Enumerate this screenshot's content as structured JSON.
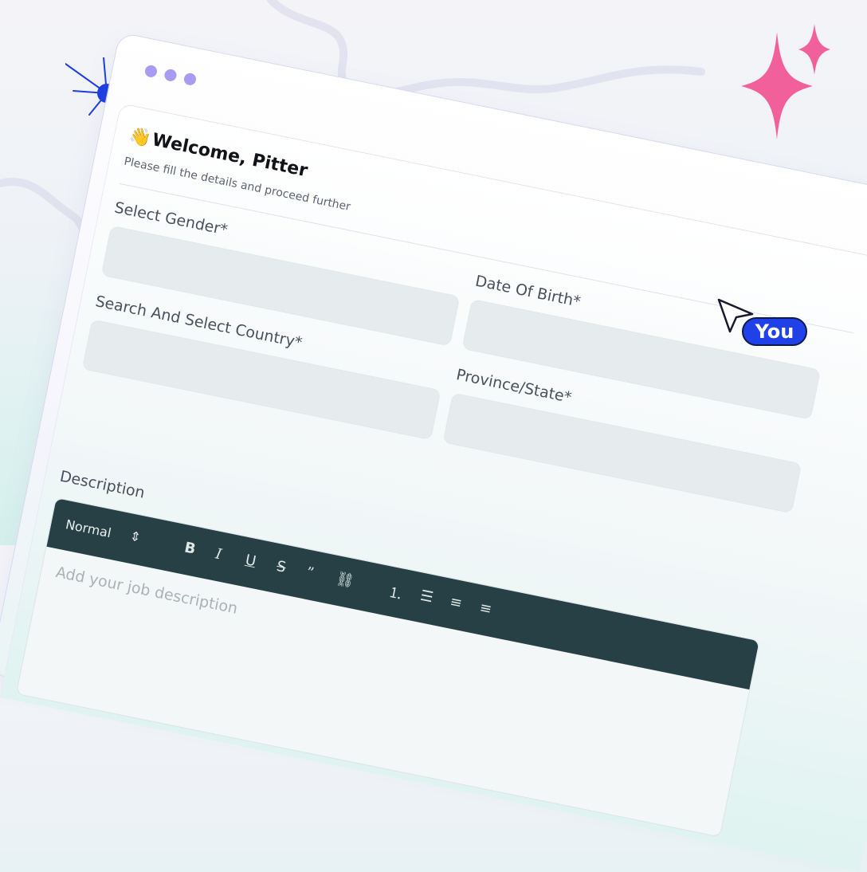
{
  "window": {
    "dots": 3
  },
  "header": {
    "wave": "👋",
    "title": "Welcome, Pitter",
    "subtitle": "Please fill the details and proceed further"
  },
  "form": {
    "gender_label": "Select Gender*",
    "dob_label": "Date Of Birth*",
    "country_label": "Search And Select Country*",
    "province_label": "Province/State*",
    "description_label": "Description"
  },
  "editor": {
    "style_select": "Normal",
    "placeholder": "Add your job description",
    "icons": [
      "bold-icon",
      "italic-icon",
      "underline-icon",
      "strikethrough-icon",
      "quote-icon",
      "link-icon",
      "ordered-list-icon",
      "bullet-list-icon",
      "align-left-icon",
      "align-center-icon"
    ]
  },
  "cursor_label": "You",
  "colors": {
    "accent_purple": "#a79cf2",
    "you_badge": "#2141e8",
    "pink_star": "#f2609c",
    "blue_star": "#1b3fe0",
    "toolbar": "#274045"
  }
}
